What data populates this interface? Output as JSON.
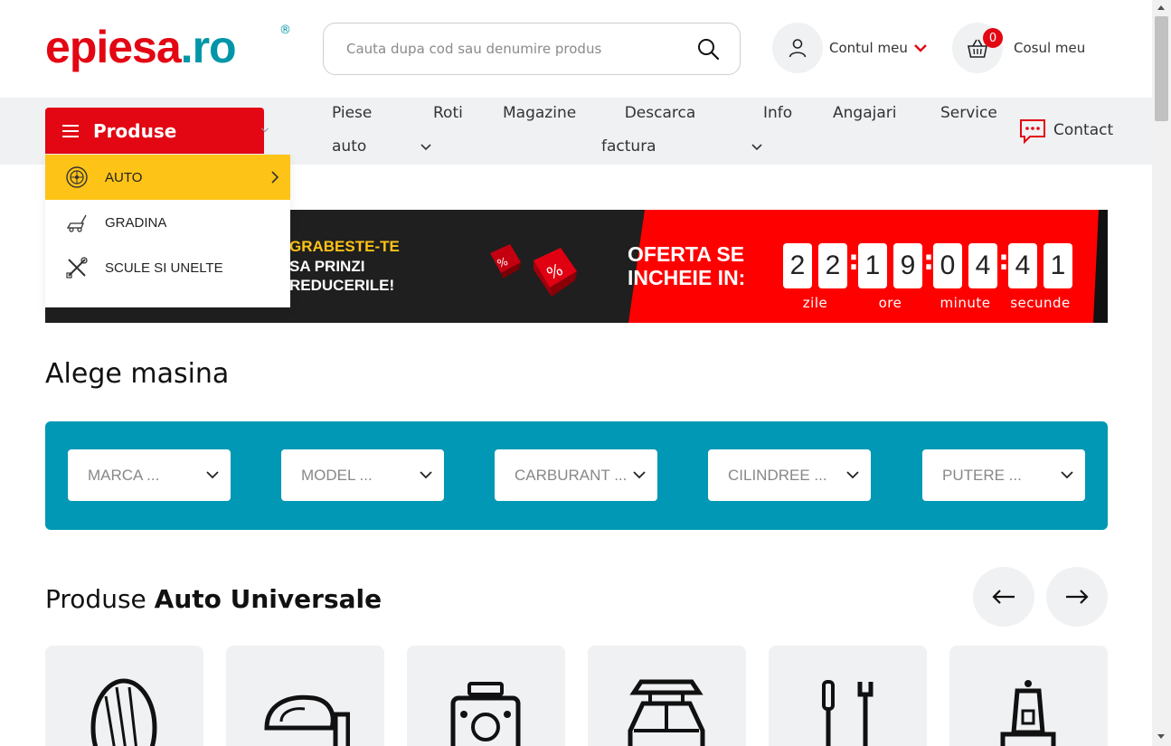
{
  "header": {
    "logo": {
      "part1": "e",
      "part2": "piesa",
      "part3": ".ro",
      "reg": "®"
    },
    "search_placeholder": "Cauta dupa cod sau denumire produs",
    "account_label": "Contul meu",
    "cart_label": "Cosul meu",
    "cart_count": "0"
  },
  "nav": {
    "produse_label": "Produse",
    "items": [
      {
        "line1": "Piese",
        "line2": "auto"
      },
      {
        "line1": "Roti",
        "line2": ""
      },
      {
        "line1": "Magazine",
        "line2": ""
      },
      {
        "line1": "Descarca",
        "line2": "factura"
      },
      {
        "line1": "Info",
        "line2": ""
      },
      {
        "line1": "Angajari",
        "line2": ""
      },
      {
        "line1": "Service",
        "line2": ""
      }
    ],
    "contact_label": "Contact"
  },
  "dropdown": {
    "items": [
      "AUTO",
      "GRADINA",
      "SCULE SI UNELTE"
    ]
  },
  "banner": {
    "line1": "GRABESTE-TE",
    "line2": "SA PRINZI",
    "line3": "REDUCERILE!",
    "offer_line1": "OFERTA SE",
    "offer_line2": "INCHEIE IN:",
    "countdown": [
      {
        "digits": [
          "2",
          "2"
        ],
        "label": "zile"
      },
      {
        "digits": [
          "1",
          "9"
        ],
        "label": "ore"
      },
      {
        "digits": [
          "0",
          "4"
        ],
        "label": "minute"
      },
      {
        "digits": [
          "4",
          "1"
        ],
        "label": "secunde"
      }
    ]
  },
  "car_select": {
    "title": "Alege masina",
    "fields": [
      "MARCA ...",
      "MODEL ...",
      "CARBURANT ...",
      "CILINDREE ...",
      "PUTERE ..."
    ]
  },
  "products": {
    "title_light": "Produse ",
    "title_bold": "Auto Universale",
    "prev_symbol": "←",
    "next_symbol": "→",
    "cards": [
      "tire-icon",
      "mirror-icon",
      "engine-icon",
      "car-roof-box-icon",
      "tools-icon",
      "bulb-icon"
    ]
  },
  "colors": {
    "brand_red": "#e30613",
    "brand_teal": "#0096a8",
    "accent_yellow": "#fdc317",
    "select_bg": "#0098b4"
  }
}
